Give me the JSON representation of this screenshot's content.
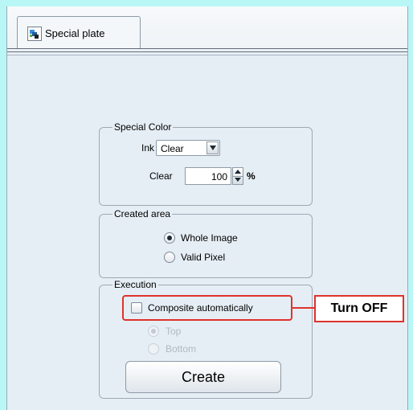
{
  "tab": {
    "label": "Special plate",
    "icon": "special-plate-icon"
  },
  "special_color": {
    "title": "Special Color",
    "ink_label": "Ink",
    "ink_value": "Clear",
    "clear_label": "Clear",
    "clear_value": "100",
    "unit": "%"
  },
  "created_area": {
    "title": "Created area",
    "options": [
      {
        "label": "Whole Image",
        "selected": true
      },
      {
        "label": "Valid Pixel",
        "selected": false
      }
    ]
  },
  "execution": {
    "title": "Execution",
    "composite_label": "Composite automatically",
    "composite_checked": false,
    "position_options": [
      {
        "label": "Top",
        "selected": true,
        "enabled": false
      },
      {
        "label": "Bottom",
        "selected": false,
        "enabled": false
      }
    ],
    "create_label": "Create"
  },
  "annotation": {
    "text": "Turn OFF",
    "color": "#e0322b"
  },
  "colors": {
    "outer_background": "#b9f6f6",
    "panel_background": "#e6eef5"
  }
}
